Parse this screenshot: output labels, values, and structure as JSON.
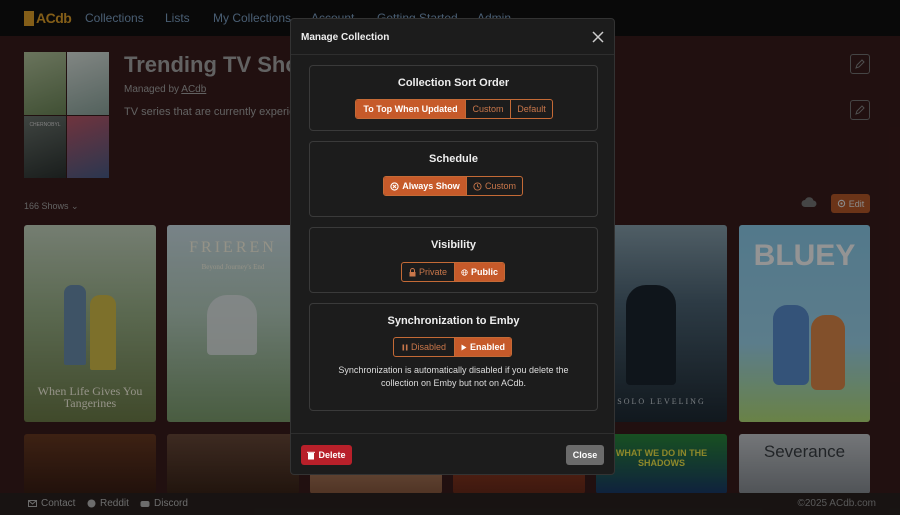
{
  "navbar": {
    "logo_text": "ACdb",
    "items": [
      "Collections",
      "Lists",
      "My Collections",
      "Account",
      "Getting Started",
      "Admin"
    ]
  },
  "collection": {
    "title": "Trending TV Shows",
    "managed_by_label": "Managed by",
    "managed_by": "ACdb",
    "description": "TV series that are currently experiencing a surge in popularity",
    "count_label": "166 Shows",
    "edit_label": "Edit"
  },
  "posters": {
    "p1_title": "When Life Gives You Tangerines",
    "p2_title": "FRIEREN",
    "p2_subtitle": "Beyond Journey's End",
    "p5_title": "SOLO LEVELING",
    "p6_title": "BLUEY",
    "row2_p4_title": "WHAT WE DO IN THE SHADOWS",
    "row2_p6_title": "Severance",
    "cover_tile_text": "CHERNOBYL"
  },
  "modal": {
    "title": "Manage Collection",
    "sort": {
      "title": "Collection Sort Order",
      "options": [
        "To Top When Updated",
        "Custom",
        "Default"
      ],
      "selected": "To Top When Updated"
    },
    "schedule": {
      "title": "Schedule",
      "options": [
        "Always Show",
        "Custom"
      ],
      "selected": "Always Show"
    },
    "visibility": {
      "title": "Visibility",
      "options": [
        "Private",
        "Public"
      ],
      "selected": "Public"
    },
    "sync": {
      "title": "Synchronization to Emby",
      "options": [
        "Disabled",
        "Enabled"
      ],
      "selected": "Enabled",
      "note": "Synchronization is automatically disabled if you delete the collection on Emby but not on ACdb."
    },
    "delete_label": "Delete",
    "close_label": "Close"
  },
  "footer": {
    "links": [
      "Contact",
      "Reddit",
      "Discord"
    ],
    "copyright": "©2025 ACdb.com"
  },
  "colors": {
    "accent": "#c65a2a",
    "danger": "#b8202a",
    "nav_link": "#7fa2c7"
  }
}
